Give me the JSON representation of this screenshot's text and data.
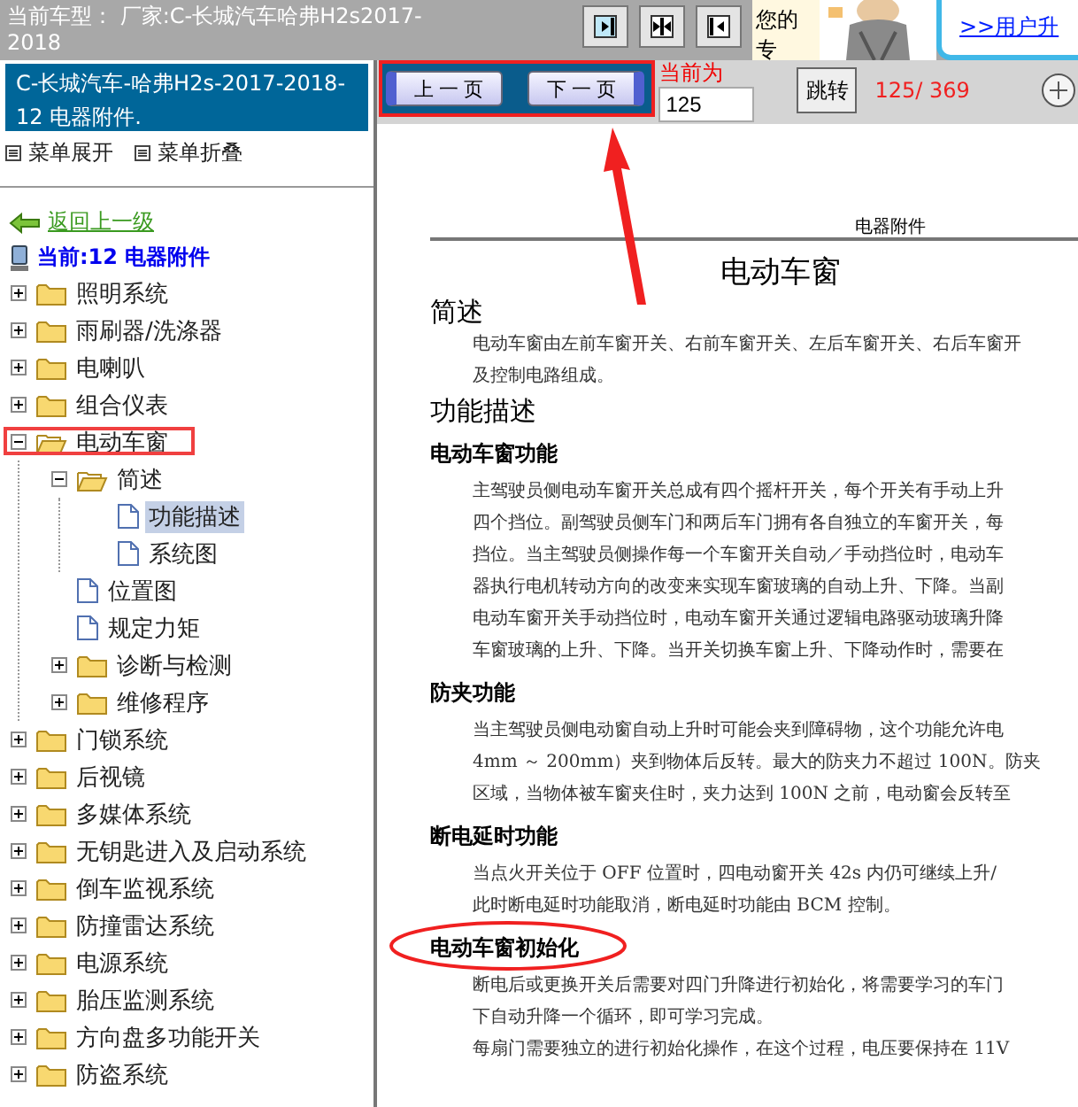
{
  "top_bar": {
    "model_label": "当前车型： 厂家:C-长城汽车哈弗H2s2017-2018",
    "slogan": "您的专",
    "user_link": ">>用户升"
  },
  "sidebar": {
    "title": "C-长城汽车-哈弗H2s-2017-2018- 12 电器附件.",
    "expand_all": "菜单展开",
    "collapse_all": "菜单折叠",
    "back_link": "返回上一级",
    "current": "当前:12 电器附件",
    "tree": [
      {
        "label": "照明系统",
        "kind": "folder",
        "expanded": false,
        "selected": false,
        "annotated": false
      },
      {
        "label": "雨刷器/洗涤器",
        "kind": "folder",
        "expanded": false,
        "selected": false,
        "annotated": false
      },
      {
        "label": "电喇叭",
        "kind": "folder",
        "expanded": false,
        "selected": false,
        "annotated": false
      },
      {
        "label": "组合仪表",
        "kind": "folder",
        "expanded": false,
        "selected": false,
        "annotated": false
      },
      {
        "label": "电动车窗",
        "kind": "folder",
        "expanded": true,
        "selected": false,
        "annotated": true,
        "children": [
          {
            "label": "简述",
            "kind": "folder",
            "expanded": true,
            "selected": false,
            "annotated": false,
            "children": [
              {
                "label": "功能描述",
                "kind": "page",
                "selected": true,
                "annotated": false
              },
              {
                "label": "系统图",
                "kind": "page",
                "selected": false,
                "annotated": false
              }
            ]
          },
          {
            "label": "位置图",
            "kind": "page",
            "selected": false,
            "annotated": false
          },
          {
            "label": "规定力矩",
            "kind": "page",
            "selected": false,
            "annotated": false
          },
          {
            "label": "诊断与检测",
            "kind": "folder",
            "expanded": false,
            "selected": false,
            "annotated": false
          },
          {
            "label": "维修程序",
            "kind": "folder",
            "expanded": false,
            "selected": false,
            "annotated": false
          }
        ]
      },
      {
        "label": "门锁系统",
        "kind": "folder",
        "expanded": false,
        "selected": false,
        "annotated": false
      },
      {
        "label": "后视镜",
        "kind": "folder",
        "expanded": false,
        "selected": false,
        "annotated": false
      },
      {
        "label": "多媒体系统",
        "kind": "folder",
        "expanded": false,
        "selected": false,
        "annotated": false
      },
      {
        "label": "无钥匙进入及启动系统",
        "kind": "folder",
        "expanded": false,
        "selected": false,
        "annotated": false
      },
      {
        "label": "倒车监视系统",
        "kind": "folder",
        "expanded": false,
        "selected": false,
        "annotated": false
      },
      {
        "label": "防撞雷达系统",
        "kind": "folder",
        "expanded": false,
        "selected": false,
        "annotated": false
      },
      {
        "label": "电源系统",
        "kind": "folder",
        "expanded": false,
        "selected": false,
        "annotated": false
      },
      {
        "label": "胎压监测系统",
        "kind": "folder",
        "expanded": false,
        "selected": false,
        "annotated": false
      },
      {
        "label": "方向盘多功能开关",
        "kind": "folder",
        "expanded": false,
        "selected": false,
        "annotated": false
      },
      {
        "label": "防盗系统",
        "kind": "folder",
        "expanded": false,
        "selected": false,
        "annotated": false
      }
    ]
  },
  "toolbar": {
    "prev_button": "上 一 页",
    "next_button": "下 一 页",
    "page_label": "当前为",
    "page_value": "125",
    "go_button": "跳转",
    "page_count": "125/ 369"
  },
  "document": {
    "header": "电器附件",
    "title": "电动车窗",
    "blocks": [
      {
        "kind": "h1",
        "text": "简述"
      },
      {
        "kind": "p",
        "lines": [
          "电动车窗由左前车窗开关、右前车窗开关、左后车窗开关、右后车窗开",
          "及控制电路组成。"
        ]
      },
      {
        "kind": "h1",
        "text": "功能描述"
      },
      {
        "kind": "h2",
        "text": "电动车窗功能",
        "circled": false
      },
      {
        "kind": "p",
        "lines": [
          "主驾驶员侧电动车窗开关总成有四个摇杆开关，每个开关有手动上升",
          "四个挡位。副驾驶员侧车门和两后车门拥有各自独立的车窗开关，每",
          "挡位。当主驾驶员侧操作每一个车窗开关自动／手动挡位时，电动车",
          "器执行电机转动方向的改变来实现车窗玻璃的自动上升、下降。当副",
          "电动车窗开关手动挡位时，电动车窗开关通过逻辑电路驱动玻璃升降",
          "车窗玻璃的上升、下降。当开关切换车窗上升、下降动作时，需要在"
        ]
      },
      {
        "kind": "h2",
        "text": "防夹功能",
        "circled": false
      },
      {
        "kind": "p",
        "lines": [
          "当主驾驶员侧电动窗自动上升时可能会夹到障碍物，这个功能允许电",
          "4mm ～ 200mm）夹到物体后反转。最大的防夹力不超过 100N。防夹",
          "区域，当物体被车窗夹住时，夹力达到 100N 之前，电动窗会反转至"
        ]
      },
      {
        "kind": "h2",
        "text": "断电延时功能",
        "circled": false
      },
      {
        "kind": "p",
        "lines": [
          "当点火开关位于 OFF 位置时，四电动窗开关 42s 内仍可继续上升/",
          "此时断电延时功能取消，断电延时功能由 BCM 控制。"
        ]
      },
      {
        "kind": "h2",
        "text": "电动车窗初始化",
        "circled": true
      },
      {
        "kind": "p",
        "lines": [
          "断电后或更换开关后需要对四门升降进行初始化，将需要学习的车门",
          "下自动升降一个循环，即可学习完成。",
          "每扇门需要独立的进行初始化操作，在这个过程，电压要保持在 11V"
        ]
      }
    ]
  }
}
